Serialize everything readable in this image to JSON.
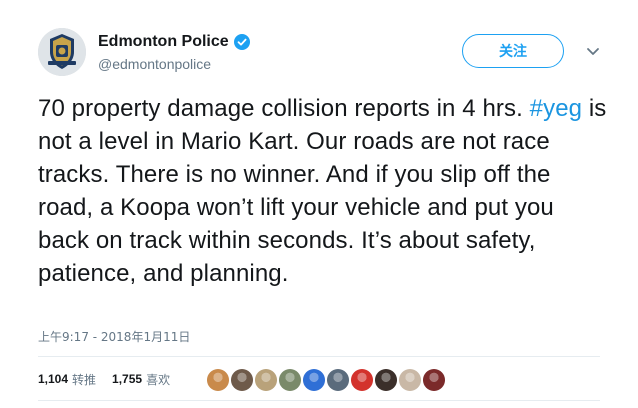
{
  "account": {
    "display_name": "Edmonton Police",
    "handle": "@edmontonpolice",
    "verified_icon": "verified-badge-icon",
    "avatar_icon": "police-crest-icon"
  },
  "actions": {
    "follow_label": "关注",
    "more_icon": "chevron-down-icon"
  },
  "tweet": {
    "text_part1": "70 property damage collision reports in 4 hrs.",
    "hashtag": "#yeg",
    "text_part2": " is not a level in Mario Kart. Our roads are not race tracks. There is no winner. And if you slip off the road, a Koopa won’t lift your vehicle and put you back on track within seconds. It’s about safety, patience, and planning.",
    "timestamp": "上午9:17 - 2018年1月11日"
  },
  "stats": {
    "retweets_count": "1,104",
    "retweets_label": "转推",
    "likes_count": "1,755",
    "likes_label": "喜欢"
  },
  "likers": [
    {
      "icon": "liker-avatar-1",
      "color": "#c98a4b"
    },
    {
      "icon": "liker-avatar-2",
      "color": "#6e5a4a"
    },
    {
      "icon": "liker-avatar-3",
      "color": "#b9a27a"
    },
    {
      "icon": "liker-avatar-4",
      "color": "#7a8a6a"
    },
    {
      "icon": "liker-avatar-5",
      "color": "#2f6fd6"
    },
    {
      "icon": "liker-avatar-6",
      "color": "#5a6b7c"
    },
    {
      "icon": "liker-avatar-7",
      "color": "#d3322c"
    },
    {
      "icon": "liker-avatar-8",
      "color": "#3b2f2a"
    },
    {
      "icon": "liker-avatar-9",
      "color": "#c9b8a6"
    },
    {
      "icon": "liker-avatar-10",
      "color": "#7b2a2a"
    }
  ],
  "colors": {
    "link": "#1b95e0",
    "accent": "#1da1f2",
    "muted": "#657786"
  }
}
